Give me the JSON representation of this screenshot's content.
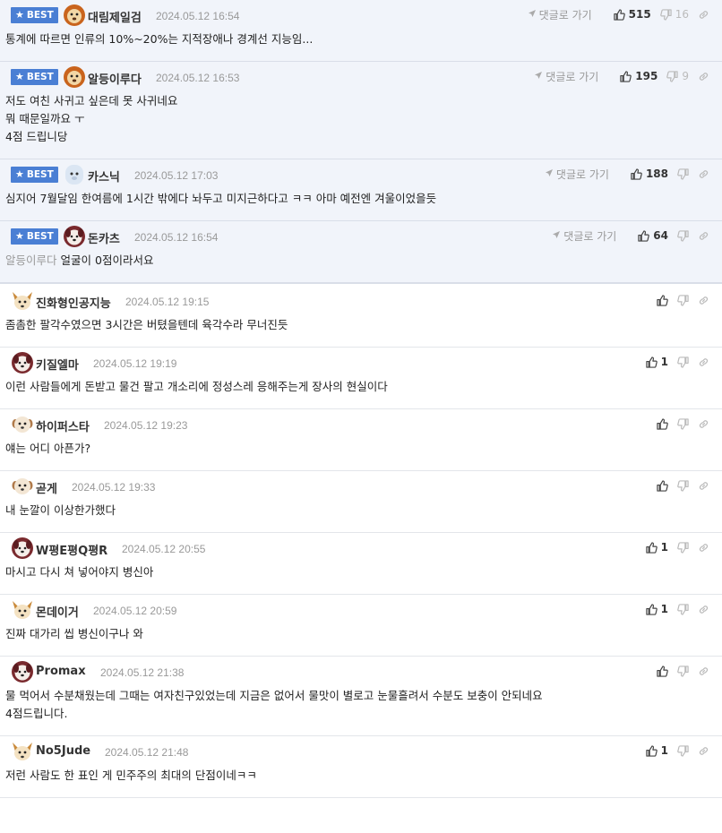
{
  "reply_label": "댓글로 가기",
  "best_label": "BEST",
  "best_comments": [
    {
      "nick": "대림제일검",
      "date": "2024.05.12 16:54",
      "up": "515",
      "down": "16",
      "lines": [
        "통계에 따르면 인류의 10%~20%는 지적장애나 경계선 지능임..."
      ],
      "avatar": "lion"
    },
    {
      "nick": "알등이루다",
      "date": "2024.05.12 16:53",
      "up": "195",
      "down": "9",
      "lines": [
        "저도 여친 사귀고 싶은데 못 사귀네요",
        "뭐 때문일까요 ㅜ",
        "4점 드립니당"
      ],
      "avatar": "lion"
    },
    {
      "nick": "카스닉",
      "date": "2024.05.12 17:03",
      "up": "188",
      "down": "",
      "lines": [
        "심지어 7월달임 한여름에 1시간 밖에다 놔두고 미지근하다고 ㅋㅋ 아마 예전엔 겨울이었을듯"
      ],
      "avatar": "ghost"
    },
    {
      "nick": "돈카츠",
      "date": "2024.05.12 16:54",
      "up": "64",
      "down": "",
      "mention": "알등이루다",
      "lines": [
        "얼굴이 0점이라서요"
      ],
      "avatar": "dog"
    }
  ],
  "comments": [
    {
      "nick": "진화형인공지능",
      "date": "2024.05.12 19:15",
      "up": "",
      "lines": [
        "좀촘한 팔각수였으면 3시간은 버텼을텐데 육각수라 무너진듯"
      ],
      "avatar": "fox"
    },
    {
      "nick": "키질엘마",
      "date": "2024.05.12 19:19",
      "up": "1",
      "lines": [
        "이런 사람들에게 돈받고 물건 팔고 개소리에 정성스레 응해주는게 장사의 현실이다"
      ],
      "avatar": "dog"
    },
    {
      "nick": "하이퍼스타",
      "date": "2024.05.12 19:23",
      "up": "",
      "lines": [
        "얘는 어디 아픈가?"
      ],
      "avatar": "puppy"
    },
    {
      "nick": "곧게",
      "date": "2024.05.12 19:33",
      "up": "",
      "lines": [
        "내 눈깔이 이상한가했다"
      ],
      "avatar": "puppy"
    },
    {
      "nick": "W평E평Q평R",
      "date": "2024.05.12 20:55",
      "up": "1",
      "lines": [
        "마시고 다시 쳐 넣어야지 병신아"
      ],
      "avatar": "dog"
    },
    {
      "nick": "몬데이거",
      "date": "2024.05.12 20:59",
      "up": "1",
      "lines": [
        "진짜 대가리 씹 병신이구나 와"
      ],
      "avatar": "fox"
    },
    {
      "nick": "Promax",
      "date": "2024.05.12 21:38",
      "up": "",
      "lines": [
        "물 먹어서 수분채웠는데 그때는 여자친구있었는데 지금은 없어서 물맛이 별로고 눈물흘려서 수분도 보충이 안되네요",
        "4점드립니다."
      ],
      "avatar": "dog"
    },
    {
      "nick": "No5Jude",
      "date": "2024.05.12 21:48",
      "up": "1",
      "lines": [
        "저런 사람도 한 표인 게 민주주의 최대의 단점이네ㅋㅋ"
      ],
      "avatar": "fox"
    }
  ]
}
